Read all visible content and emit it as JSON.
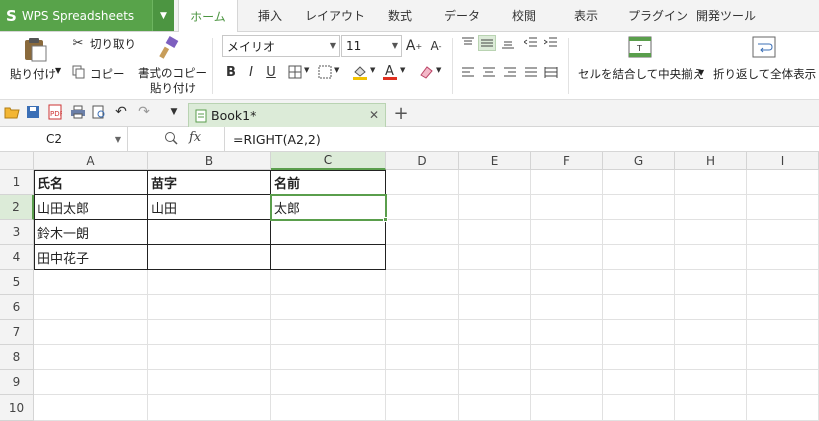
{
  "app": {
    "name": "WPS Spreadsheets",
    "logo_letter": "S"
  },
  "menu_tabs": [
    "ホーム",
    "挿入",
    "レイアウト",
    "数式",
    "データ",
    "校閲",
    "表示",
    "プラグイン",
    "開発ツール"
  ],
  "active_tab": "ホーム",
  "ribbon": {
    "paste": "貼り付け",
    "cut": "切り取り",
    "copy": "コピー",
    "format_copy_line1": "書式のコピー",
    "format_copy_line2": "貼り付け",
    "font_name": "メイリオ",
    "font_size": "11",
    "bold": "B",
    "italic": "I",
    "underline": "U",
    "merge_center": "セルを結合して中央揃え",
    "wrap_text": "折り返して全体表示"
  },
  "document_tab": {
    "name": "Book1*"
  },
  "formula_bar": {
    "cell_ref": "C2",
    "fx": "fx",
    "formula": "=RIGHT(A2,2)"
  },
  "sheet": {
    "columns": [
      "A",
      "B",
      "C",
      "D",
      "E",
      "F",
      "G",
      "H",
      "I"
    ],
    "rows": [
      "1",
      "2",
      "3",
      "4",
      "5",
      "6",
      "7",
      "8",
      "9",
      "10"
    ],
    "selected_column": "C",
    "selected_row": "2",
    "cells": {
      "A1": "氏名",
      "B1": "苗字",
      "C1": "名前",
      "A2": "山田太郎",
      "B2": "山田",
      "C2": "太郎",
      "A3": "鈴木一朗",
      "A4": "田中花子"
    }
  },
  "colors": {
    "accent": "#58a34a",
    "selection": "#5a9e4c",
    "header_selected": "#dcebd8"
  }
}
